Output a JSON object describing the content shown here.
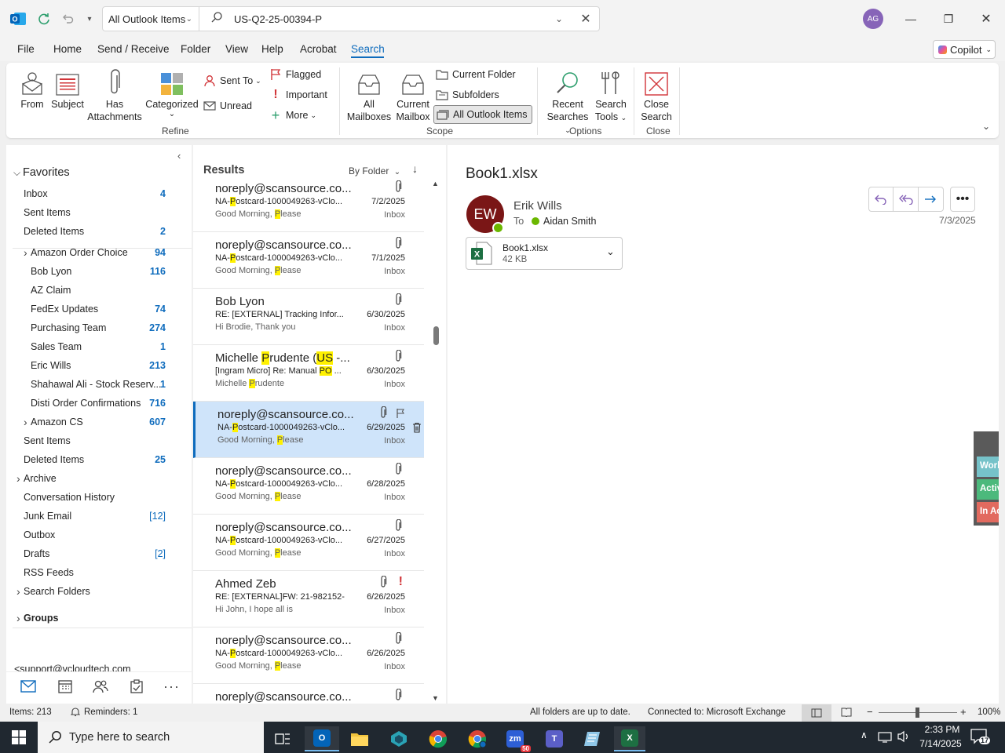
{
  "titlebar": {
    "scope": "All Outlook Items",
    "search_value": "US-Q2-25-00394-P",
    "avatar_initials": "AG"
  },
  "menu": [
    "File",
    "Home",
    "Send / Receive",
    "Folder",
    "View",
    "Help",
    "Acrobat",
    "Search"
  ],
  "copilot_label": "Copilot",
  "ribbon": {
    "refine": {
      "from": "From",
      "subject": "Subject",
      "has_attachments_1": "Has",
      "has_attachments_2": "Attachments",
      "categorized": "Categorized",
      "sent_to": "Sent To",
      "unread": "Unread",
      "flagged": "Flagged",
      "important": "Important",
      "more": "More",
      "label": "Refine"
    },
    "scope": {
      "all_mailboxes_1": "All",
      "all_mailboxes_2": "Mailboxes",
      "current_mailbox_1": "Current",
      "current_mailbox_2": "Mailbox",
      "current_folder": "Current Folder",
      "subfolders": "Subfolders",
      "all_outlook_items": "All Outlook Items",
      "label": "Scope"
    },
    "options": {
      "recent_1": "Recent",
      "recent_2": "Searches",
      "tools_1": "Search",
      "tools_2": "Tools",
      "label": "Options"
    },
    "close": {
      "close_1": "Close",
      "close_2": "Search",
      "label": "Close"
    }
  },
  "folders": {
    "favorites": "Favorites",
    "items": [
      {
        "label": "Inbox",
        "count": "4"
      },
      {
        "label": "Sent Items",
        "count": ""
      },
      {
        "label": "Deleted Items",
        "count": "2"
      },
      {
        "label": "Amazon Order Choice",
        "count": "94"
      },
      {
        "label": "Bob Lyon",
        "count": "116"
      },
      {
        "label": "AZ Claim",
        "count": ""
      },
      {
        "label": "FedEx Updates",
        "count": "74"
      },
      {
        "label": "Purchasing Team",
        "count": "274"
      },
      {
        "label": "Sales Team",
        "count": "1"
      },
      {
        "label": "Eric Wills",
        "count": "213"
      },
      {
        "label": "Shahawal Ali - Stock Reserv...",
        "count": "1"
      },
      {
        "label": "Disti Order Confirmations",
        "count": "716"
      },
      {
        "label": "Amazon CS",
        "count": "607"
      },
      {
        "label": "Sent Items",
        "count": ""
      },
      {
        "label": "Deleted Items",
        "count": "25"
      },
      {
        "label": "Archive",
        "count": ""
      },
      {
        "label": "Conversation History",
        "count": ""
      },
      {
        "label": "Junk Email",
        "count": "[12]"
      },
      {
        "label": "Outbox",
        "count": ""
      },
      {
        "label": "Drafts",
        "count": "[2]"
      },
      {
        "label": "RSS Feeds",
        "count": ""
      },
      {
        "label": "Search Folders",
        "count": ""
      },
      {
        "label": "Groups",
        "count": ""
      },
      {
        "label": "<support@vcloudtech.com",
        "count": ""
      }
    ]
  },
  "results": {
    "title": "Results",
    "sort": "By Folder",
    "messages": [
      {
        "from": "noreply@scansource.co...",
        "subj_a": "NA-",
        "subj_h": "P",
        "subj_b": "ostcard-1000049263-vClo...",
        "prev_a": "Good Morning, ",
        "prev_h": "P",
        "prev_b": "lease",
        "date": "7/2/2025",
        "folder": "Inbox"
      },
      {
        "from": "noreply@scansource.co...",
        "subj_a": "NA-",
        "subj_h": "P",
        "subj_b": "ostcard-1000049263-vClo...",
        "prev_a": "Good Morning, ",
        "prev_h": "P",
        "prev_b": "lease",
        "date": "7/1/2025",
        "folder": "Inbox"
      },
      {
        "from": "Bob Lyon",
        "subj_a": "RE: [EXTERNAL] Tracking Infor...",
        "subj_h": "",
        "subj_b": "",
        "prev_a": "Hi Brodie,  Thank you",
        "prev_h": "",
        "prev_b": "",
        "date": "6/30/2025",
        "folder": "Inbox"
      },
      {
        "from_a": "Michelle ",
        "from_h1": "P",
        "from_b": "rudente (",
        "from_h2": "US",
        "from_c": " -...",
        "subj_a": "[Ingram Micro] Re: Manual ",
        "subj_h": "PO",
        "subj_b": " ...",
        "prev_a": "Michelle ",
        "prev_h": "P",
        "prev_b": "rudente",
        "date": "6/30/2025",
        "folder": "Inbox"
      },
      {
        "from": "noreply@scansource.co...",
        "subj_a": "NA-",
        "subj_h": "P",
        "subj_b": "ostcard-1000049263-vClo...",
        "prev_a": "Good Morning, ",
        "prev_h": "P",
        "prev_b": "lease",
        "date": "6/29/2025",
        "folder": "Inbox"
      },
      {
        "from": "noreply@scansource.co...",
        "subj_a": "NA-",
        "subj_h": "P",
        "subj_b": "ostcard-1000049263-vClo...",
        "prev_a": "Good Morning, ",
        "prev_h": "P",
        "prev_b": "lease",
        "date": "6/28/2025",
        "folder": "Inbox"
      },
      {
        "from": "noreply@scansource.co...",
        "subj_a": "NA-",
        "subj_h": "P",
        "subj_b": "ostcard-1000049263-vClo...",
        "prev_a": "Good Morning, ",
        "prev_h": "P",
        "prev_b": "lease",
        "date": "6/27/2025",
        "folder": "Inbox"
      },
      {
        "from": "Ahmed Zeb",
        "subj_a": "RE: [EXTERNAL]FW: 21-982152-...",
        "subj_h": "",
        "subj_b": "",
        "prev_a": "Hi John,  I hope all is",
        "prev_h": "",
        "prev_b": "",
        "date": "6/26/2025",
        "folder": "Inbox"
      },
      {
        "from": "noreply@scansource.co...",
        "subj_a": "NA-",
        "subj_h": "P",
        "subj_b": "ostcard-1000049263-vClo...",
        "prev_a": "Good Morning, ",
        "prev_h": "P",
        "prev_b": "lease",
        "date": "6/26/2025",
        "folder": "Inbox"
      },
      {
        "from": "noreply@scansource.co...",
        "subj_a": "",
        "subj_h": "",
        "subj_b": "",
        "prev_a": "",
        "prev_h": "",
        "prev_b": "",
        "date": "",
        "folder": ""
      }
    ]
  },
  "reading": {
    "subject": "Book1.xlsx",
    "sender_initials": "EW",
    "sender_name": "Erik Wills",
    "to_label": "To",
    "recipient": "Aidan Smith",
    "date": "7/3/2025",
    "attachment_name": "Book1.xlsx",
    "attachment_size": "42 KB",
    "side_tabs": [
      "Worl",
      "Activ",
      "In Ac"
    ]
  },
  "status": {
    "items": "Items: 213",
    "reminders": "Reminders: 1",
    "sync": "All folders are up to date.",
    "connection": "Connected to: Microsoft Exchange",
    "zoom": "100%"
  },
  "taskbar": {
    "search_placeholder": "Type here to search",
    "time": "2:33 PM",
    "date": "7/14/2025",
    "notif_count": "17",
    "zoom_badge": "50"
  }
}
